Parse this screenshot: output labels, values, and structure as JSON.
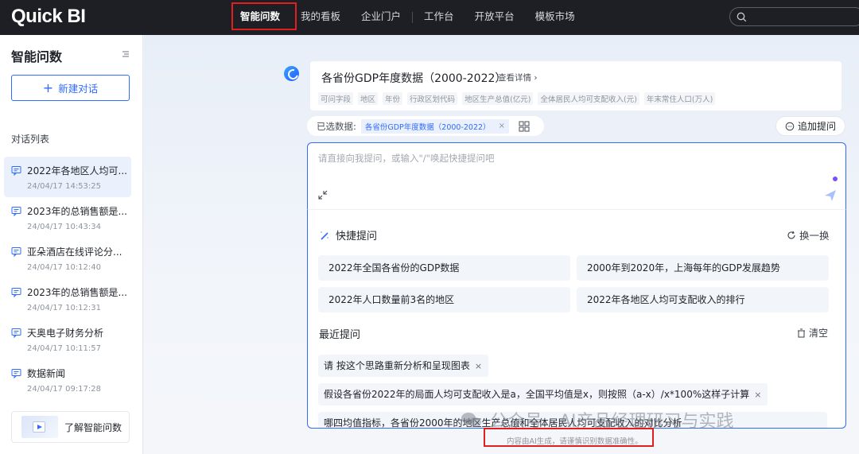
{
  "header": {
    "logo": "Quick BI",
    "nav": [
      "智能问数",
      "我的看板",
      "企业门户",
      "工作台",
      "开放平台",
      "模板市场"
    ],
    "search_placeholder": ""
  },
  "sidebar": {
    "title": "智能问数",
    "new_chat": "新建对话",
    "section": "对话列表",
    "conversations": [
      {
        "title": "2022年各地区人均可...",
        "time": "24/04/17 14:53:25"
      },
      {
        "title": "2023年的总销售额是...",
        "time": "24/04/17 10:43:34"
      },
      {
        "title": "亚朵酒店在线评论分...",
        "time": "24/04/17 10:12:40"
      },
      {
        "title": "2023年的总销售额是...",
        "time": "24/04/17 10:12:31"
      },
      {
        "title": "天奥电子财务分析",
        "time": "24/04/17 10:11:57"
      },
      {
        "title": "数据新闻",
        "time": "24/04/17 09:17:28"
      }
    ],
    "learn": "了解智能问数"
  },
  "dataset": {
    "title": "各省份GDP年度数据（2000-2022）",
    "detail": "查看详情",
    "fields": [
      "可问字段",
      "地区",
      "年份",
      "行政区划代码",
      "地区生产总值(亿元)",
      "全体居民人均可支配收入(元)",
      "年末常住人口(万人)"
    ]
  },
  "selection": {
    "label": "已选数据:",
    "tag": "各省份GDP年度数据（2000-2022）",
    "tag_close": "×"
  },
  "followup": "追加提问",
  "input": {
    "placeholder": "请直接向我提问，或输入\"/\"唤起快捷提问吧"
  },
  "quick": {
    "title": "快捷提问",
    "refresh": "换一换",
    "suggestions": [
      "2022年全国各省份的GDP数据",
      "2000年到2020年，上海每年的GDP发展趋势",
      "2022年人口数量前3名的地区",
      "2022年各地区人均可支配收入的排行"
    ]
  },
  "recent": {
    "title": "最近提问",
    "clear": "清空",
    "items": [
      "请 按这个思路重新分析和呈现图表",
      "假设各省份2022年的局面人均可支配收入是a，全国平均值是x，则按照（a-x）/x*100%这样子计算",
      "哪四均值指标，各省份2000年的地区生产总值和全体居民人均可支配收入的对比分析"
    ],
    "close": "×"
  },
  "disclaimer": "内容由AI生成，请谨慎识别数据准确性。",
  "watermark": "公众号 · AI产品经理研习与实践",
  "colors": {
    "accent": "#2f6bff",
    "nav_bg": "#1d1f24",
    "highlight": "#e02020"
  }
}
